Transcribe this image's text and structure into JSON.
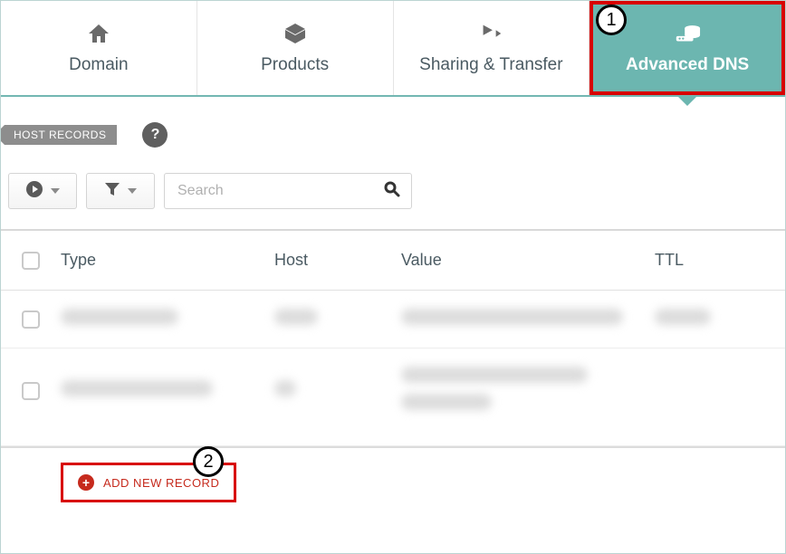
{
  "tabs": [
    {
      "label": "Domain"
    },
    {
      "label": "Products"
    },
    {
      "label": "Sharing & Transfer"
    },
    {
      "label": "Advanced DNS",
      "active": true
    }
  ],
  "section": {
    "title": "HOST RECORDS",
    "help_glyph": "?"
  },
  "toolbar": {
    "search_placeholder": "Search"
  },
  "table": {
    "columns": [
      "Type",
      "Host",
      "Value",
      "TTL"
    ],
    "rows_blurred": 2
  },
  "footer": {
    "add_label": "ADD NEW RECORD"
  },
  "annotations": {
    "step1": "1",
    "step2": "2",
    "highlight_color": "#d80000"
  },
  "colors": {
    "accent_teal": "#6cb6b0",
    "text": "#4a5a62",
    "danger": "#c62a1d"
  }
}
